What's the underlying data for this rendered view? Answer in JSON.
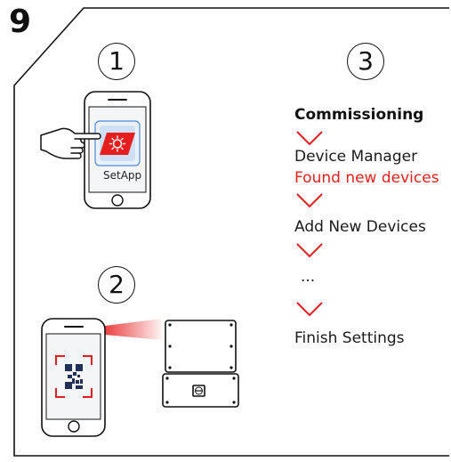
{
  "step_number": "9",
  "steps": {
    "one": "1",
    "two": "2",
    "three": "3"
  },
  "phone_app_label": "SetApp",
  "commissioning": {
    "title": "Commissioning",
    "items": [
      "Device Manager",
      "Found new devices",
      "Add New Devices",
      "...",
      "Finish Settings"
    ]
  },
  "colors": {
    "accent_red": "#e61e1e",
    "app_icon_blue": "#4f8bd6",
    "outline": "#111111"
  },
  "icons": [
    "pointing-hand-icon",
    "app-icon",
    "qr-code-icon",
    "chevron-down-icon",
    "inverter-device-icon"
  ]
}
